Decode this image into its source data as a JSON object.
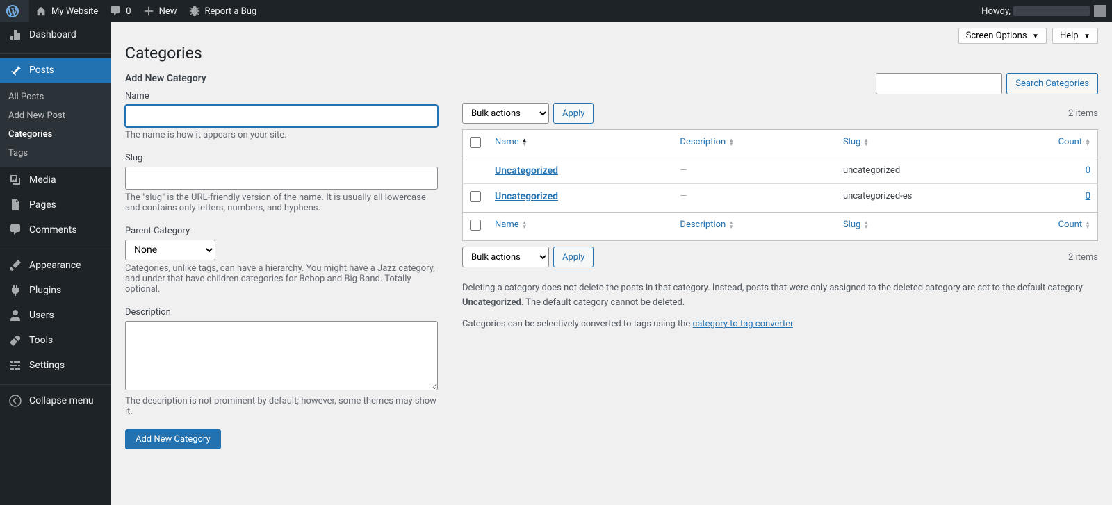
{
  "adminbar": {
    "site_name": "My Website",
    "comments_count": "0",
    "new_label": "New",
    "bug_label": "Report a Bug",
    "howdy": "Howdy,"
  },
  "sidebar": {
    "dashboard": "Dashboard",
    "posts": "Posts",
    "submenu": {
      "all_posts": "All Posts",
      "add_new": "Add New Post",
      "categories": "Categories",
      "tags": "Tags"
    },
    "media": "Media",
    "pages": "Pages",
    "comments": "Comments",
    "appearance": "Appearance",
    "plugins": "Plugins",
    "users": "Users",
    "tools": "Tools",
    "settings": "Settings",
    "collapse": "Collapse menu"
  },
  "top_controls": {
    "screen_options": "Screen Options",
    "help": "Help"
  },
  "page": {
    "title": "Categories"
  },
  "form": {
    "heading": "Add New Category",
    "name_label": "Name",
    "name_help": "The name is how it appears on your site.",
    "slug_label": "Slug",
    "slug_help": "The \"slug\" is the URL-friendly version of the name. It is usually all lowercase and contains only letters, numbers, and hyphens.",
    "parent_label": "Parent Category",
    "parent_option": "None",
    "parent_help": "Categories, unlike tags, can have a hierarchy. You might have a Jazz category, and under that have children categories for Bebop and Big Band. Totally optional.",
    "desc_label": "Description",
    "desc_help": "The description is not prominent by default; however, some themes may show it.",
    "submit": "Add New Category"
  },
  "search": {
    "btn": "Search Categories"
  },
  "bulk": {
    "label": "Bulk actions",
    "apply": "Apply"
  },
  "count_label": "2 items",
  "table": {
    "headers": {
      "name": "Name",
      "description": "Description",
      "slug": "Slug",
      "count": "Count"
    },
    "rows": [
      {
        "name": "Uncategorized",
        "description": "—",
        "slug": "uncategorized",
        "count": "0",
        "checkbox": false
      },
      {
        "name": "Uncategorized",
        "description": "—",
        "slug": "uncategorized-es",
        "count": "0",
        "checkbox": true
      }
    ]
  },
  "notes": {
    "p1a": "Deleting a category does not delete the posts in that category. Instead, posts that were only assigned to the deleted category are set to the default category ",
    "p1b": "Uncategorized",
    "p1c": ". The default category cannot be deleted.",
    "p2a": "Categories can be selectively converted to tags using the ",
    "p2link": "category to tag converter",
    "p2b": "."
  }
}
